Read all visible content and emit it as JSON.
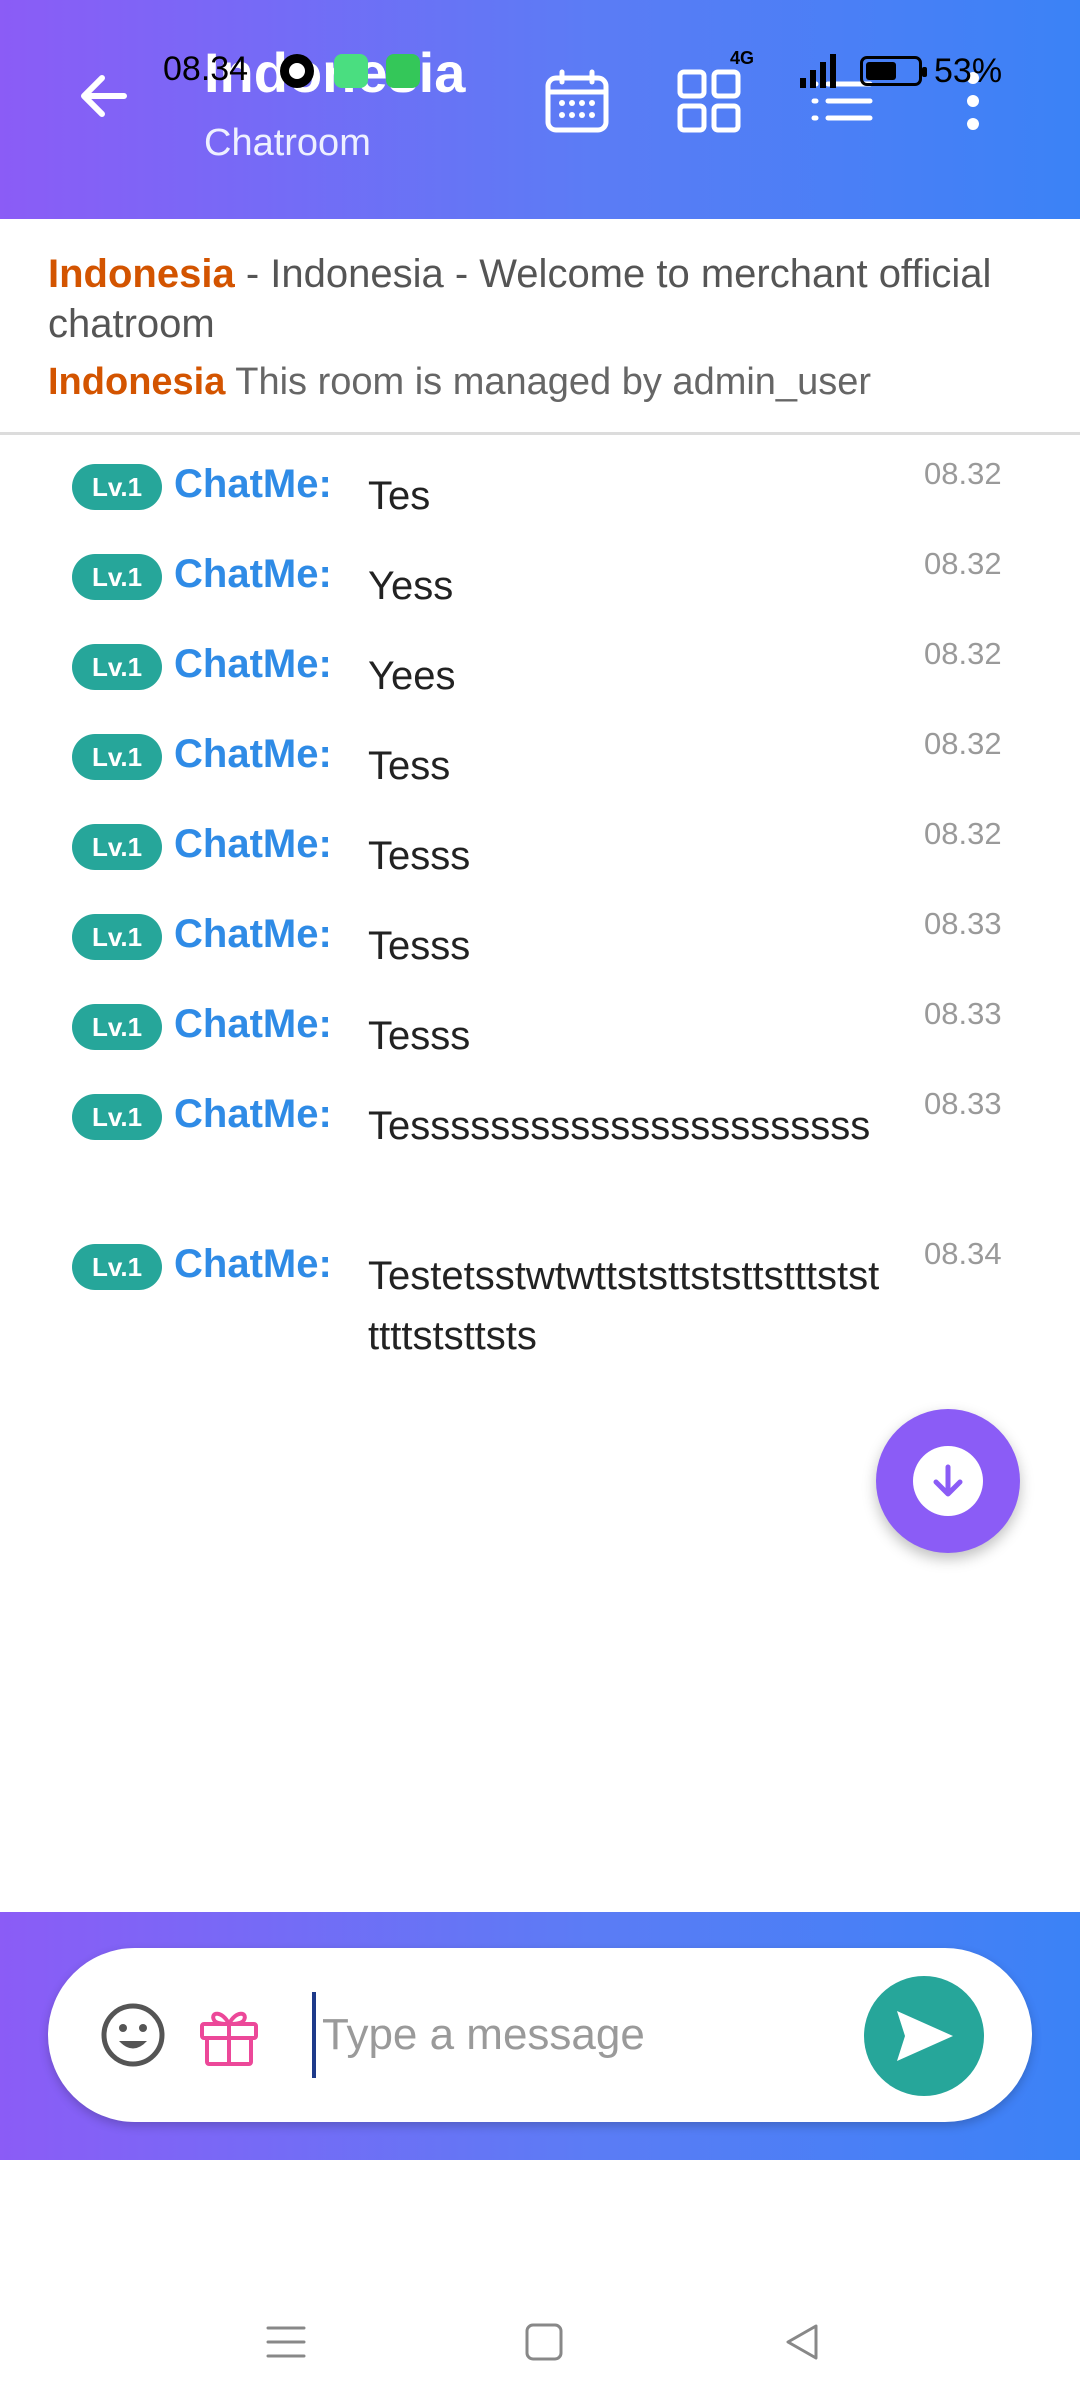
{
  "status_bar": {
    "time": "08.34",
    "network": "4G",
    "battery": "53%"
  },
  "header": {
    "title": "Indonesia",
    "subtitle": "Chatroom",
    "icons": [
      "back-arrow-icon",
      "calendar-icon",
      "grid-icon",
      "list-icon",
      "more-vert-icon"
    ]
  },
  "announcement": {
    "room_tag": "Indonesia",
    "welcome_text": " - Indonesia - Welcome to merchant official chatroom",
    "managed_tag": "Indonesia",
    "managed_text": " This room is managed by admin_user"
  },
  "messages": [
    {
      "level": "Lv.1",
      "sender": "ChatMe:",
      "text": "Tes",
      "time": "08.32"
    },
    {
      "level": "Lv.1",
      "sender": "ChatMe:",
      "text": "Yess",
      "time": "08.32"
    },
    {
      "level": "Lv.1",
      "sender": "ChatMe:",
      "text": "Yees",
      "time": "08.32"
    },
    {
      "level": "Lv.1",
      "sender": "ChatMe:",
      "text": "Tess",
      "time": "08.32"
    },
    {
      "level": "Lv.1",
      "sender": "ChatMe:",
      "text": "Tesss",
      "time": "08.32"
    },
    {
      "level": "Lv.1",
      "sender": "ChatMe:",
      "text": "Tesss",
      "time": "08.33"
    },
    {
      "level": "Lv.1",
      "sender": "ChatMe:",
      "text": "Tesss",
      "time": "08.33"
    },
    {
      "level": "Lv.1",
      "sender": "ChatMe:",
      "text": "Tesssssssssssssssssssssss",
      "time": "08.33"
    },
    {
      "level": "Lv.1",
      "sender": "ChatMe:",
      "text": "Testetsstwtwttststtststtstttststttttststtsts",
      "time": "08.34"
    }
  ],
  "composer": {
    "placeholder": "Type a message",
    "value": ""
  },
  "colors": {
    "header_gradient_start": "#8b5cf6",
    "header_gradient_end": "#3b82f6",
    "room_tag": "#d35400",
    "sender": "#2f8be6",
    "badge": "#26a69a",
    "send_button": "#26a69a"
  }
}
